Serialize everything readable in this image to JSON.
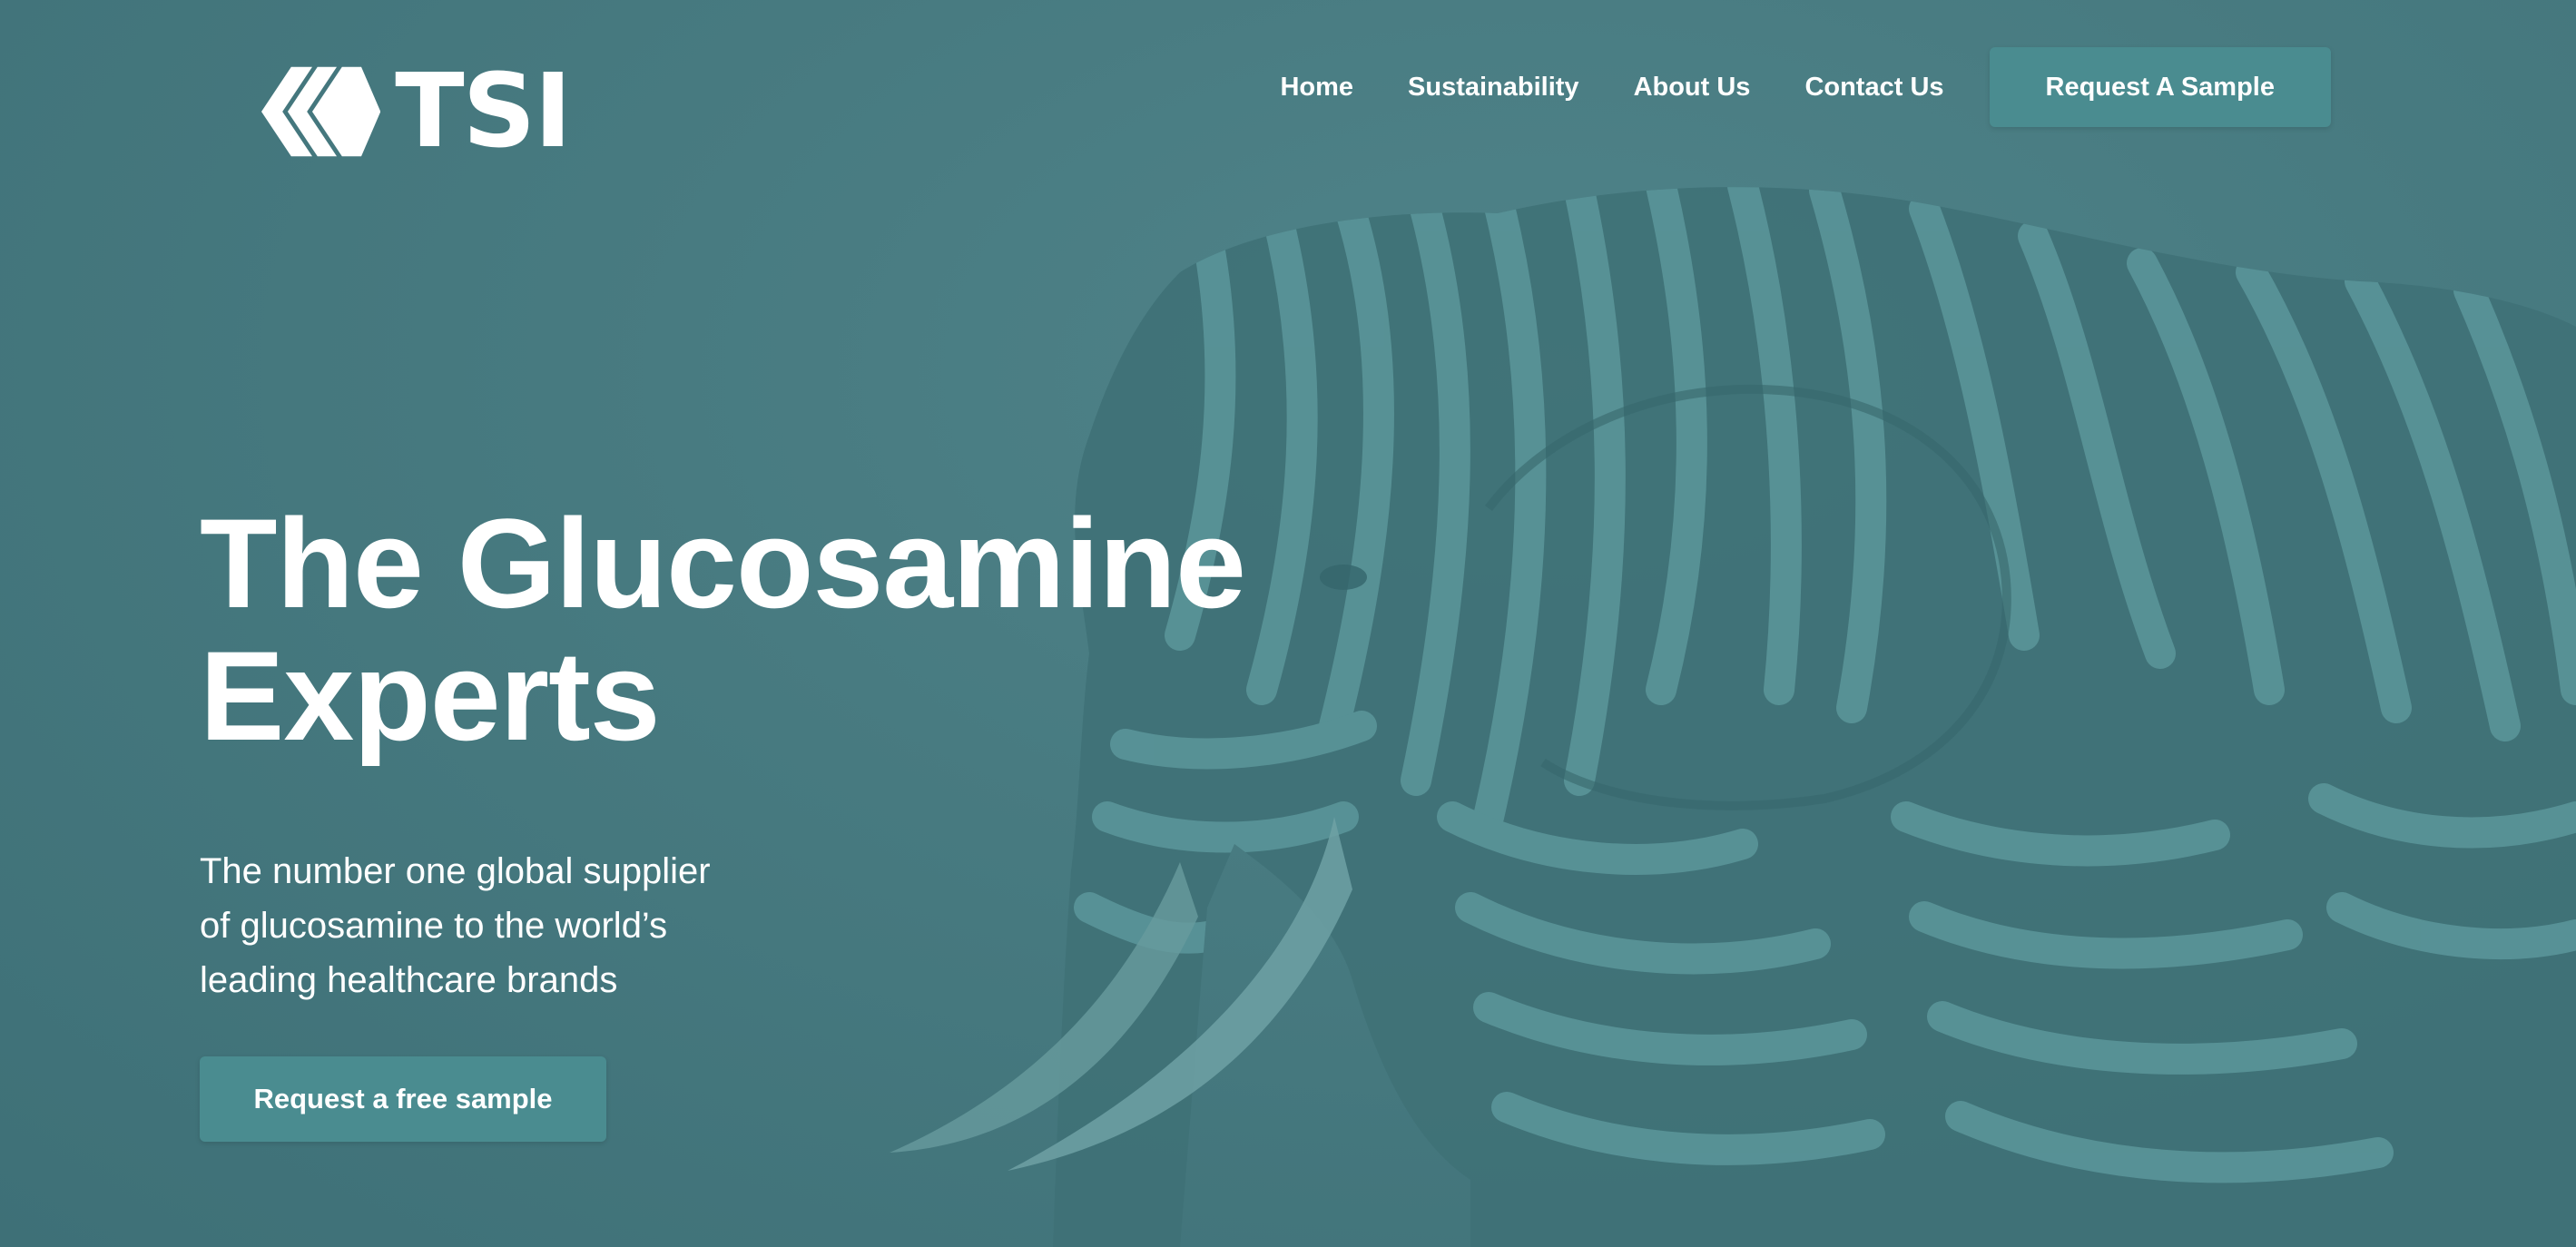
{
  "brand": {
    "logo_text": "TSI",
    "logo_icon": "chevron-diamond-icon"
  },
  "nav": {
    "links": [
      "Home",
      "Sustainability",
      "About Us",
      "Contact Us"
    ],
    "cta_label": "Request A Sample"
  },
  "hero": {
    "headline_line1": "The Glucosamine",
    "headline_line2": "Experts",
    "subcopy_line1": "The number one global supplier",
    "subcopy_line2": "of glucosamine to the world’s",
    "subcopy_line3": "leading healthcare brands",
    "cta_label": "Request a free sample",
    "image_subject": "zebra-striped-elephant"
  },
  "colors": {
    "background": "#487a80",
    "button": "#4a8c90",
    "text": "#ffffff"
  }
}
